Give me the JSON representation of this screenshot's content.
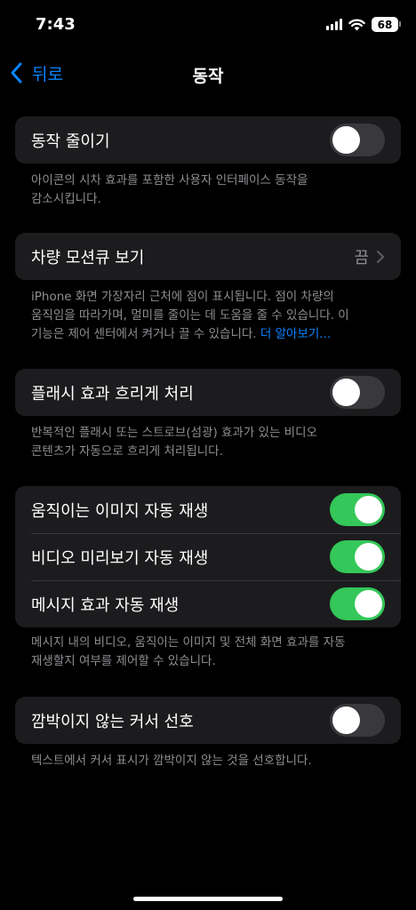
{
  "status_bar": {
    "time": "7:43",
    "battery": "68",
    "icons": [
      "cellular-signal-icon",
      "wifi-icon",
      "battery-icon"
    ]
  },
  "nav": {
    "back_label": "뒤로",
    "title": "동작"
  },
  "settings": {
    "reduce_motion": {
      "label": "동작 줄이기",
      "on": false,
      "footer": [
        "아이콘의 시차 효과를 포함한 사용자 인터페이스 동작을",
        "감소시킵니다."
      ]
    },
    "vehicle_motion_cues": {
      "label": "차량 모션큐 보기",
      "value": "끔",
      "footer": [
        "iPhone 화면 가장자리 근처에 점이 표시됩니다. 점이 차량의",
        "움직임을 따라가며, 멀미를 줄이는 데 도움을 줄 수 있습니다. 이",
        "기능은 제어 센터에서 켜거나 끌 수 있습니다."
      ],
      "footer_link": "더 알아보기..."
    },
    "dim_flashing": {
      "label": "플래시 효과 흐리게 처리",
      "on": false,
      "footer": [
        "반복적인 플래시 또는 스트로브(섬광) 효과가 있는 비디오",
        "콘텐츠가 자동으로 흐리게 처리됩니다."
      ]
    },
    "autoplay_group": {
      "rows": [
        {
          "label": "움직이는 이미지 자동 재생",
          "on": true
        },
        {
          "label": "비디오 미리보기 자동 재생",
          "on": true
        },
        {
          "label": "메시지 효과 자동 재생",
          "on": true
        }
      ],
      "footer": [
        "메시지 내의 비디오, 움직이는 이미지 및 전체 화면 효과를 자동",
        "재생할지 여부를 제어할 수 있습니다."
      ]
    },
    "non_blinking_cursor": {
      "label": "깜박이지 않는 커서 선호",
      "on": false,
      "footer": [
        "텍스트에서 커서 표시가 깜박이지 않는 것을 선호합니다."
      ]
    }
  },
  "colors": {
    "background": "#000000",
    "cell": "#1c1c1e",
    "accent": "#0a84ff",
    "toggle_on": "#34c759",
    "toggle_off": "#39393d",
    "secondary_text": "#8e8e93"
  }
}
